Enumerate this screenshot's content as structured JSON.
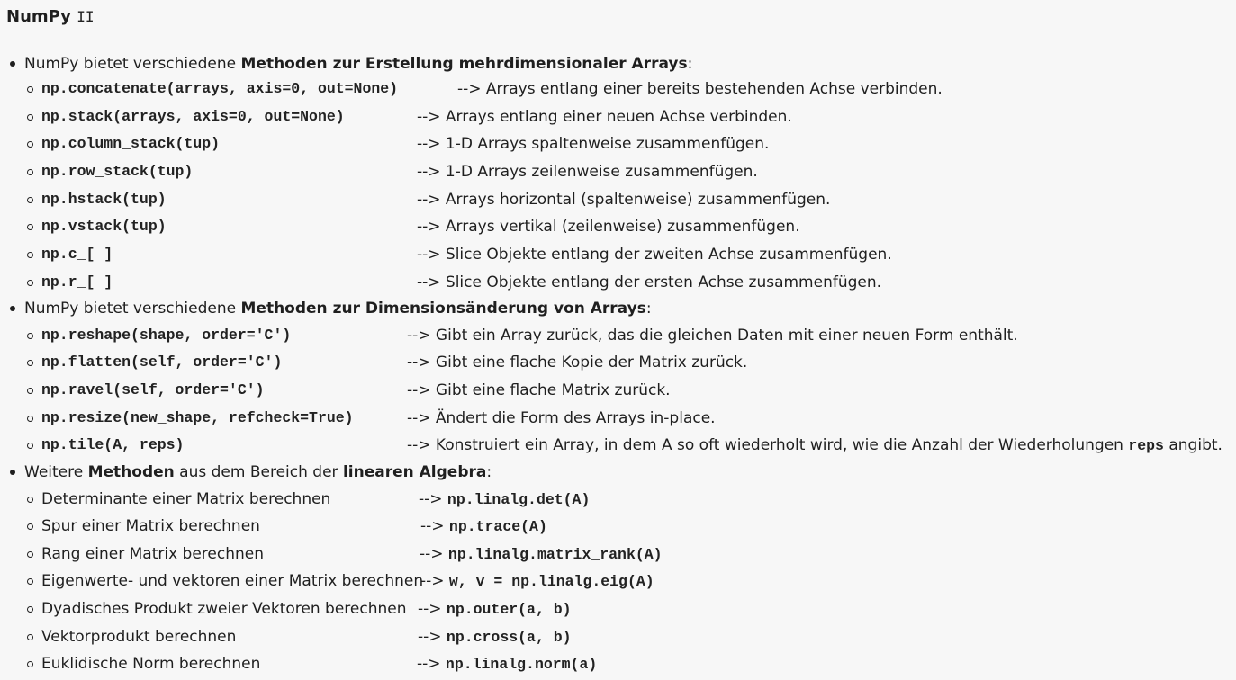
{
  "title": {
    "prefix": "NumPy",
    "suffix": "II"
  },
  "sections": [
    {
      "intro_pre": "NumPy bietet verschiedene ",
      "intro_bold": "Methoden zur Erstellung mehrdimensionaler Arrays",
      "intro_post": ":",
      "items": [
        {
          "code": "np.concatenate(arrays, axis=0, out=None)",
          "desc": "--> Arrays entlang einer bereits bestehenden Achse verbinden."
        },
        {
          "code": "np.stack(arrays, axis=0, out=None)",
          "desc": "--> Arrays entlang einer neuen Achse verbinden."
        },
        {
          "code": "np.column_stack(tup)",
          "desc": "--> 1-D Arrays spaltenweise zusammenfügen."
        },
        {
          "code": "np.row_stack(tup)",
          "desc": "--> 1-D Arrays zeilenweise zusammenfügen."
        },
        {
          "code": "np.hstack(tup)",
          "desc": "--> Arrays horizontal (spaltenweise) zusammenfügen."
        },
        {
          "code": "np.vstack(tup)",
          "desc": "--> Arrays vertikal (zeilenweise) zusammenfügen."
        },
        {
          "code": "np.c_[ ]",
          "desc": "--> Slice Objekte entlang der zweiten Achse zusammenfügen."
        },
        {
          "code": "np.r_[ ]",
          "desc": "--> Slice Objekte entlang der ersten Achse zusammenfügen."
        }
      ]
    },
    {
      "intro_pre": "NumPy bietet verschiedene ",
      "intro_bold": "Methoden zur Dimensionsänderung von Arrays",
      "intro_post": ":",
      "items": [
        {
          "code": "np.reshape(shape, order='C')",
          "desc": "--> Gibt ein Array zurück, das die gleichen Daten mit einer neuen Form enthält."
        },
        {
          "code": "np.flatten(self, order='C')",
          "desc": "--> Gibt eine flache Kopie der Matrix zurück."
        },
        {
          "code": "np.ravel(self, order='C')",
          "desc": "--> Gibt eine flache Matrix zurück."
        },
        {
          "code": "np.resize(new_shape, refcheck=True)",
          "desc": "--> Ändert die Form des Arrays in-place."
        },
        {
          "code": "np.tile(A, reps)",
          "desc": "--> Konstruiert ein Array, in dem A so oft wiederholt wird, wie die Anzahl der Wiederholungen",
          "desc_code": "reps",
          "desc_post": "angibt."
        }
      ]
    },
    {
      "intro_pre": "Weitere ",
      "intro_bold": "Methoden",
      "intro_mid": " aus dem Bereich der ",
      "intro_bold2": "linearen Algebra",
      "intro_post": ":",
      "items": [
        {
          "text": "Determinante einer Matrix berechnen",
          "arrow": "-->",
          "code": "np.linalg.det(A)"
        },
        {
          "text": "Spur einer Matrix berechnen",
          "arrow": "-->",
          "code": "np.trace(A)"
        },
        {
          "text": "Rang einer Matrix berechnen",
          "arrow": "-->",
          "code": "np.linalg.matrix_rank(A)"
        },
        {
          "text": "Eigenwerte- und vektoren einer Matrix berechnen",
          "arrow": "-->",
          "code": "w, v = np.linalg.eig(A)"
        },
        {
          "text": "Dyadisches Produkt zweier Vektoren berechnen",
          "arrow": "-->",
          "code": "np.outer(a, b)"
        },
        {
          "text": "Vektorprodukt berechnen",
          "arrow": "-->",
          "code": "np.cross(a, b)"
        },
        {
          "text": "Euklidische Norm berechnen",
          "arrow": "-->",
          "code": "np.linalg.norm(a)"
        }
      ]
    }
  ]
}
